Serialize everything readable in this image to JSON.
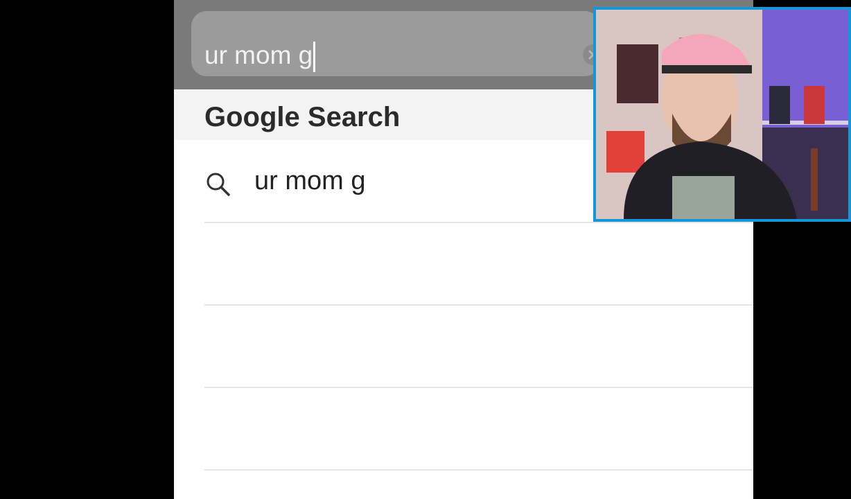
{
  "search_bar": {
    "value": "ur mom g",
    "clear_icon": "clear-x-icon"
  },
  "section": {
    "title": "Google Search"
  },
  "suggestions": [
    {
      "icon": "search-icon",
      "text": "ur mom g"
    }
  ],
  "colors": {
    "background": "#000000",
    "header_bg": "#7a7a7a",
    "field_bg": "#9b9b9b",
    "section_bg": "#f3f3f3",
    "webcam_border": "#1596d8"
  }
}
